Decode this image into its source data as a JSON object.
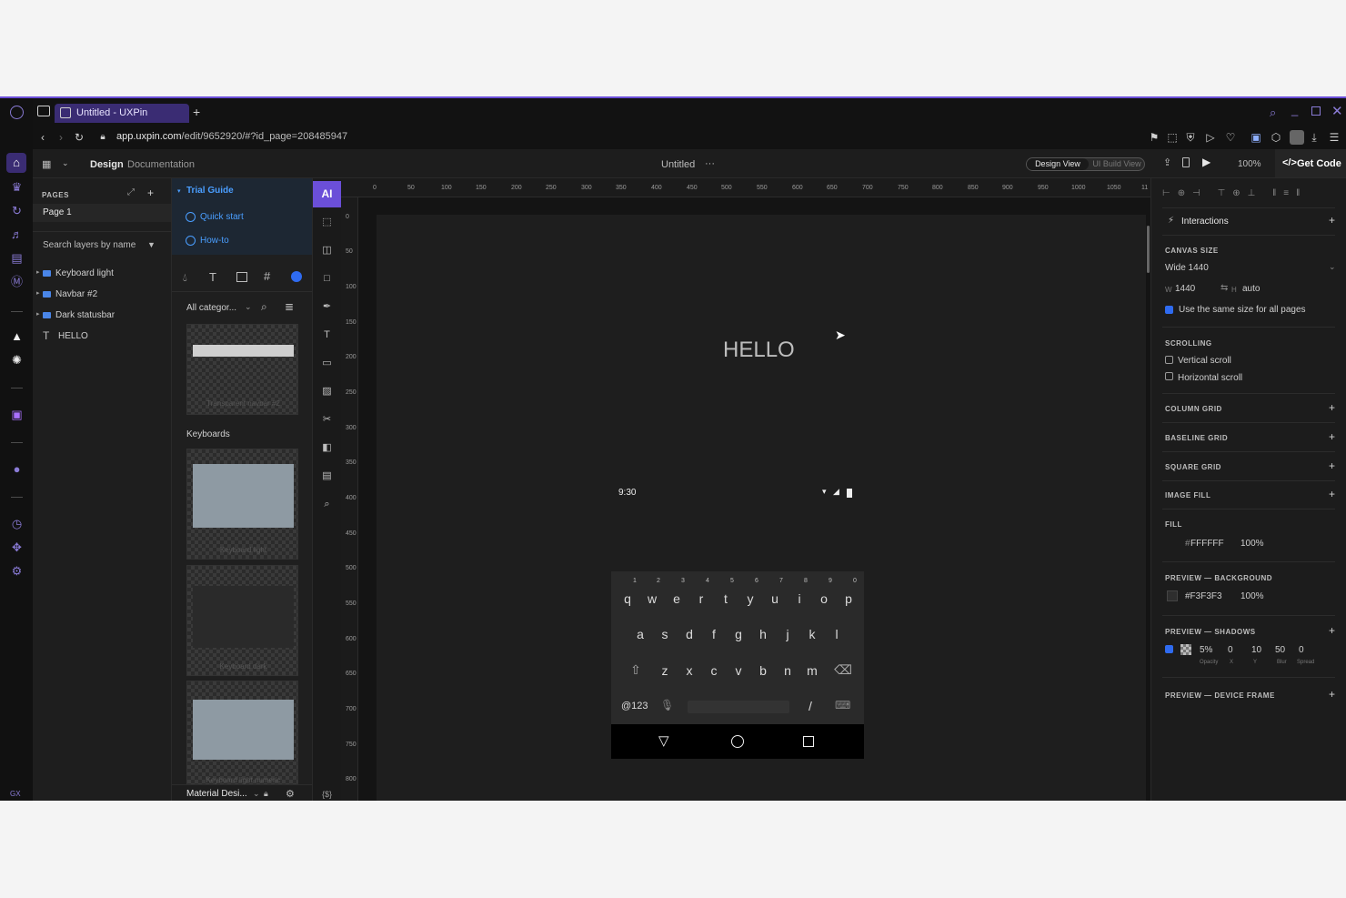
{
  "browser": {
    "tab_title": "Untitled - UXPin",
    "new_tab": "+",
    "url_host": "app.uxpin.com",
    "url_path": "/edit/9652920/#?id_page=208485947"
  },
  "header": {
    "design_tab": "Design",
    "documentation_tab": "Documentation",
    "doc_title": "Untitled",
    "more": "···",
    "design_view": "Design View",
    "ui_build_view": "UI Build View",
    "zoom": "100%",
    "get_code": "Get Code"
  },
  "pages": {
    "title": "PAGES",
    "items": [
      "Page 1"
    ],
    "search_placeholder": "Search layers by name"
  },
  "layers": [
    {
      "name": "Keyboard light",
      "type": "folder"
    },
    {
      "name": "Navbar #2",
      "type": "folder"
    },
    {
      "name": "Dark statusbar",
      "type": "folder"
    },
    {
      "name": "HELLO",
      "type": "text"
    }
  ],
  "library": {
    "trial_guide": "Trial Guide",
    "quick_start": "Quick start",
    "how_to": "How-to",
    "category": "All categor...",
    "section_keyboards": "Keyboards",
    "thumb_labels": [
      "Transparent navbar #2",
      "Keyboard light",
      "Keyboard dark",
      "Keyboard light numeric"
    ],
    "footer_library": "Material Desi..."
  },
  "toolbar": {
    "ai": "AI",
    "vars": "{$}"
  },
  "ruler": {
    "h": [
      "0",
      "50",
      "100",
      "150",
      "200",
      "250",
      "300",
      "350",
      "400",
      "450",
      "500",
      "550",
      "600",
      "650",
      "700",
      "750",
      "800",
      "850",
      "900",
      "950",
      "1000",
      "1050",
      "11"
    ],
    "v": [
      "0",
      "50",
      "100",
      "150",
      "200",
      "250",
      "300",
      "350",
      "400",
      "450",
      "500",
      "550",
      "600",
      "650",
      "700",
      "750",
      "800"
    ]
  },
  "canvas": {
    "hello": "HELLO",
    "status_time": "9:30",
    "keyboard": {
      "numbers": [
        "1",
        "2",
        "3",
        "4",
        "5",
        "6",
        "7",
        "8",
        "9",
        "0"
      ],
      "row1": [
        "q",
        "w",
        "e",
        "r",
        "t",
        "y",
        "u",
        "i",
        "o",
        "p"
      ],
      "row2": [
        "a",
        "s",
        "d",
        "f",
        "g",
        "h",
        "j",
        "k",
        "l"
      ],
      "row3": [
        "z",
        "x",
        "c",
        "v",
        "b",
        "n",
        "m"
      ],
      "sym": "@123",
      "slash": "/"
    }
  },
  "inspector": {
    "interactions": "Interactions",
    "canvas_size": "CANVAS SIZE",
    "preset": "Wide 1440",
    "w_label": "W",
    "w_value": "1440",
    "h_label": "H",
    "h_value": "auto",
    "same_size": "Use the same size for all pages",
    "scrolling": "SCROLLING",
    "vertical_scroll": "Vertical scroll",
    "horizontal_scroll": "Horizontal scroll",
    "column_grid": "COLUMN GRID",
    "baseline_grid": "BASELINE GRID",
    "square_grid": "SQUARE GRID",
    "image_fill": "IMAGE FILL",
    "fill": "FILL",
    "fill_hash": "#",
    "fill_color": "FFFFFF",
    "fill_opacity": "100%",
    "preview_bg": "PREVIEW — BACKGROUND",
    "bg_color": "#F3F3F3",
    "bg_opacity": "100%",
    "preview_shadows": "PREVIEW — SHADOWS",
    "shadow_values": [
      "5%",
      "0",
      "10",
      "50",
      "0"
    ],
    "shadow_labels": [
      "Opacity",
      "X",
      "Y",
      "Blur",
      "Spread"
    ],
    "preview_device": "PREVIEW — DEVICE FRAME"
  },
  "misc": {
    "gx": "GX"
  },
  "colors": {
    "accent": "#6b4fd8",
    "link": "#4a9eff",
    "checkbox": "#2f6bf0"
  }
}
